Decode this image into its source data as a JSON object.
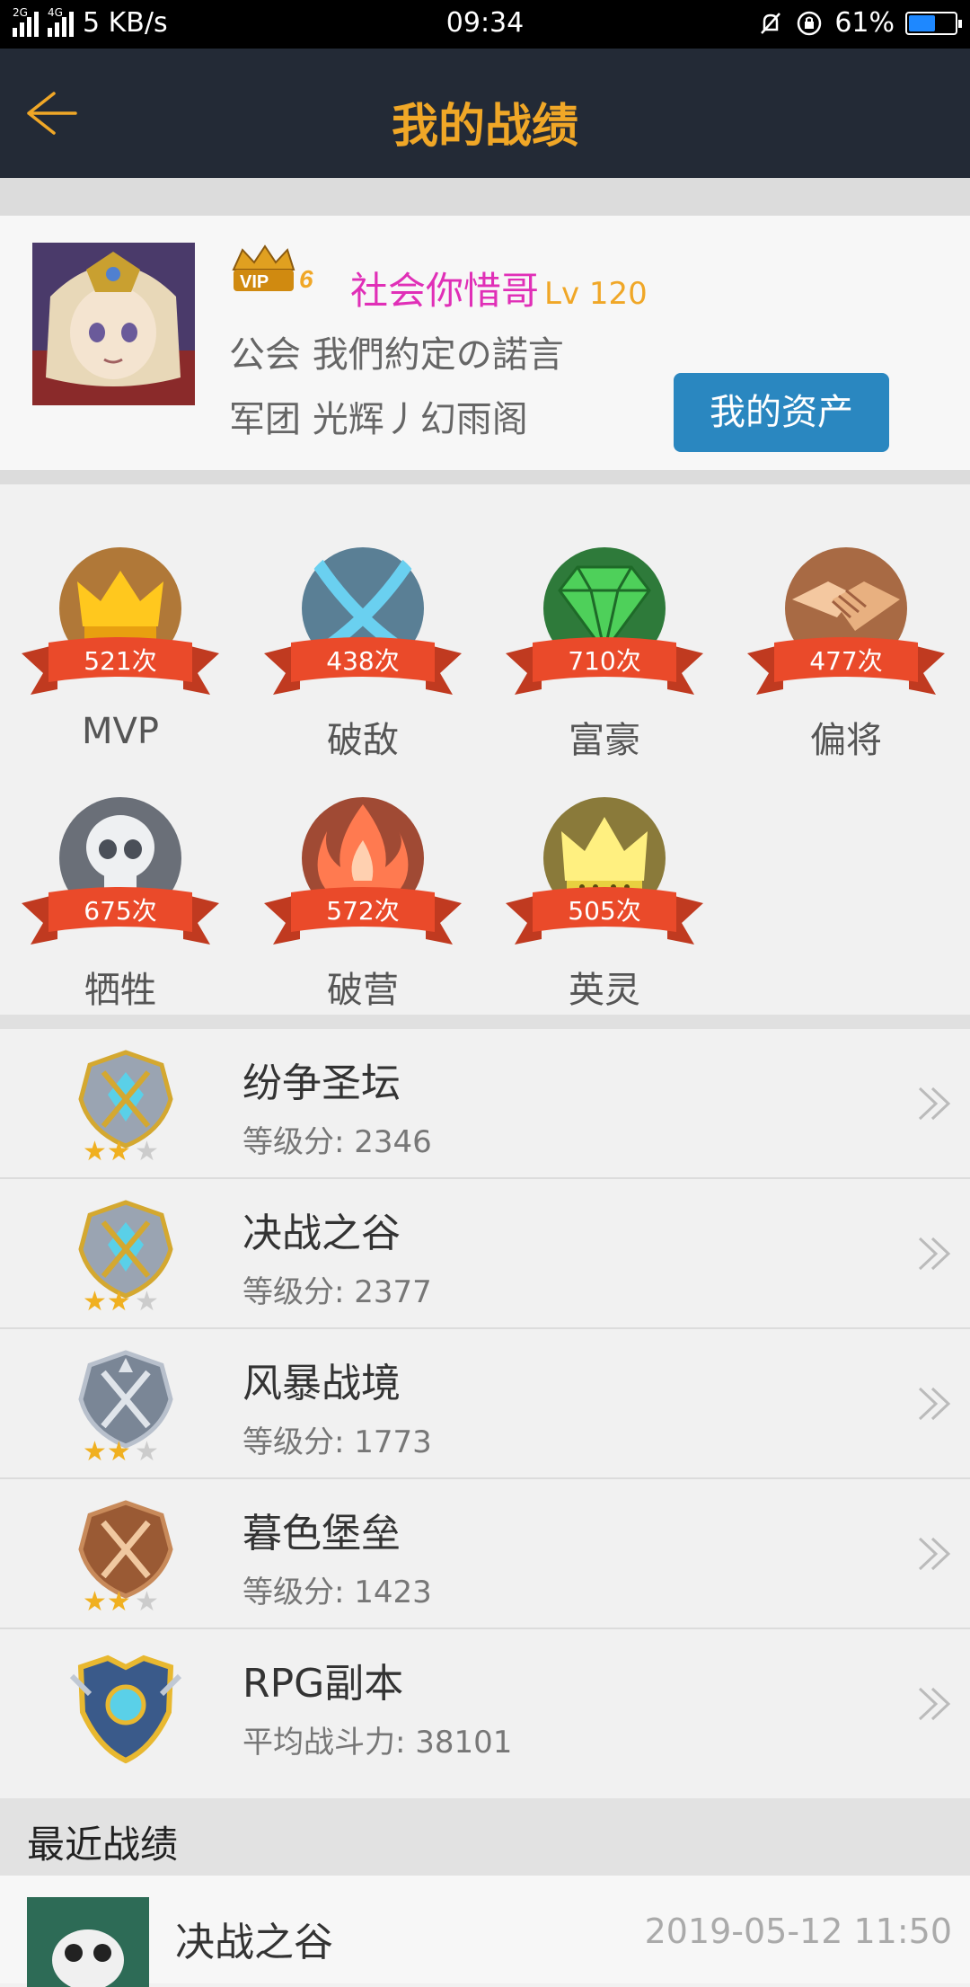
{
  "status_bar": {
    "net_2g": "2G",
    "net_4g": "4G",
    "speed": "5 KB/s",
    "time": "09:34",
    "battery": "61%",
    "battery_level": 0.61
  },
  "header": {
    "title": "我的战绩",
    "title_color": "#f0a727",
    "bg_color": "#232a36"
  },
  "profile": {
    "vip_text": "VIP",
    "vip_level": "6",
    "name": "社会你惜哥",
    "level": "Lv 120",
    "guild": "公会 我們約定の諾言",
    "legion": "军团 光辉丿幻雨阁",
    "assets_button": "我的资产",
    "name_color": "#e02fb7",
    "button_color": "#2a87c0"
  },
  "badges": [
    {
      "label": "MVP",
      "count": "521次",
      "color": "#e8a020",
      "icon": "crown-icon"
    },
    {
      "label": "破敌",
      "count": "438次",
      "color": "#5ea0c4",
      "icon": "crossed-swords-icon"
    },
    {
      "label": "富豪",
      "count": "710次",
      "color": "#3fb14a",
      "icon": "diamond-icon"
    },
    {
      "label": "偏将",
      "count": "477次",
      "color": "#d98a5a",
      "icon": "handshake-icon"
    },
    {
      "label": "牺牲",
      "count": "675次",
      "color": "#8a8f9a",
      "icon": "skull-icon"
    },
    {
      "label": "破营",
      "count": "572次",
      "color": "#d9543a",
      "icon": "flame-icon"
    },
    {
      "label": "英灵",
      "count": "505次",
      "color": "#d8c040",
      "icon": "ghost-crown-icon"
    }
  ],
  "modes": [
    {
      "name": "纷争圣坛",
      "score": "等级分: 2346",
      "emblem": "silver-gold-emblem-icon",
      "stars": 2
    },
    {
      "name": "决战之谷",
      "score": "等级分: 2377",
      "emblem": "silver-gold-emblem-icon",
      "stars": 2
    },
    {
      "name": "风暴战境",
      "score": "等级分: 1773",
      "emblem": "silver-emblem-icon",
      "stars": 2
    },
    {
      "name": "暮色堡垒",
      "score": "等级分: 1423",
      "emblem": "bronze-emblem-icon",
      "stars": 2
    },
    {
      "name": "RPG副本",
      "score": "平均战斗力: 38101",
      "emblem": "gold-emblem-icon",
      "stars": 0
    }
  ],
  "recent": {
    "heading": "最近战绩",
    "items": [
      {
        "name": "决战之谷",
        "time": "2019-05-12 11:50"
      }
    ]
  }
}
